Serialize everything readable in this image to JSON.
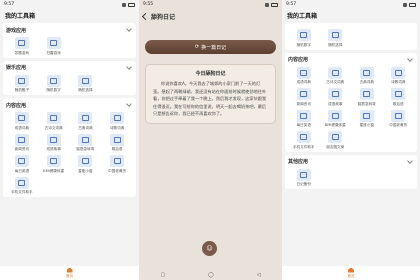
{
  "screen1": {
    "time": "9:57",
    "title": "我的工具箱",
    "sections": [
      {
        "title": "游戏应用",
        "items": [
          "答题游戏",
          "扫雷游戏"
        ]
      },
      {
        "title": "娱乐应用",
        "items": [
          "随机骰子",
          "随机数字",
          "随机选择"
        ]
      },
      {
        "title": "内容应用",
        "items": [
          "成语词典",
          "古诗文词典",
          "古典词典",
          "诗歌词典",
          "新闻资讯",
          "成语故事",
          "脑筋急转弯",
          "歇后语",
          "每日英语",
          "BMI健康体重",
          "星座小窗",
          "中国老黄历",
          "手机文件助手",
          "朋友圈文案"
        ]
      }
    ],
    "nav_home": "首页"
  },
  "screen2": {
    "time": "9:55",
    "title": "舔狗日记",
    "button": "换一篇日记",
    "card_title": "今日舔狗日记",
    "diary": "你说你喜欢A。今天我去了城郊的小家门前了一天的灯笼。昼起了两朝绿裙，我还没有站在你面前时候就使劲地往外看，你把过手牵着了我一个晚上，然后我才发现，这家伙跟我住得很近。我在写给你的信里说，明天一起去喝奶茶吧，最后只是想告诉你，我已经不再喜欢你了。",
    "fab": "☺",
    "sysnav": [
      "▢",
      "◯",
      "◁"
    ]
  },
  "screen3": {
    "time": "9:57",
    "title": "我的工具箱",
    "top_items": [
      "随机数字",
      "随机选择"
    ],
    "sections": [
      {
        "title": "内容应用",
        "items": [
          "成语词典",
          "古诗文词典",
          "古典词典",
          "诗歌词典",
          "新闻资讯",
          "成语故事",
          "脑筋急转弯",
          "歇后语",
          "每日英语",
          "BMI健康体重",
          "星座小窗",
          "中国老黄历",
          "手机文件助手",
          "朋友圈文案"
        ]
      },
      {
        "title": "其他应用",
        "items": [
          "日记备份"
        ]
      }
    ],
    "nav_home": "首页"
  }
}
